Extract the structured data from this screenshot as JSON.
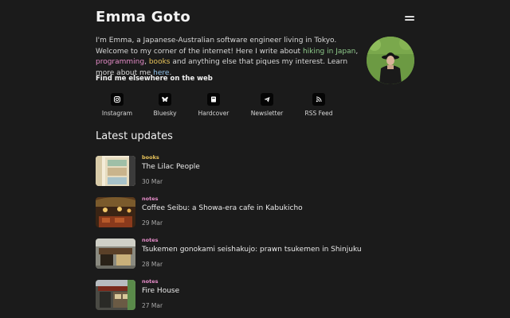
{
  "header": {
    "title": "Emma Goto",
    "menu_icon": "hamburger-menu-icon"
  },
  "intro": {
    "text_1": "I'm Emma, a Japanese-Australian software engineer living in Tokyo. Welcome to my corner of the internet! Here I write about ",
    "link_hiking": "hiking in Japan",
    "text_2": ", ",
    "link_programming": "programming",
    "text_3": ", ",
    "link_books": "books",
    "text_4": " and anything else that piques my interest. Learn more about me ",
    "link_here": "here",
    "text_5": ".",
    "link_colors": {
      "hiking": "#8ec98a",
      "programming": "#e58cc8",
      "books": "#e8c35a",
      "here": "#8fc0e8"
    }
  },
  "elsewhere": {
    "heading": "Find me elsewhere on the web",
    "links": [
      {
        "label": "Instagram",
        "icon": "instagram-icon"
      },
      {
        "label": "Bluesky",
        "icon": "bluesky-icon"
      },
      {
        "label": "Hardcover",
        "icon": "hardcover-icon"
      },
      {
        "label": "Newsletter",
        "icon": "newsletter-icon"
      },
      {
        "label": "RSS Feed",
        "icon": "rss-icon"
      }
    ]
  },
  "latest": {
    "heading": "Latest updates",
    "posts": [
      {
        "category": "books",
        "title": "The Lilac People",
        "date": "30 Mar"
      },
      {
        "category": "notes",
        "title": "Coffee Seibu: a Showa-era cafe in Kabukicho",
        "date": "29 Mar"
      },
      {
        "category": "notes",
        "title": "Tsukemen gonokami seishakujo: prawn tsukemen in Shinjuku",
        "date": "28 Mar"
      },
      {
        "category": "notes",
        "title": "Fire House",
        "date": "27 Mar"
      }
    ]
  },
  "colors": {
    "background": "#1b1b1b",
    "books_accent": "#e8c35a",
    "notes_accent": "#e58cc8"
  }
}
